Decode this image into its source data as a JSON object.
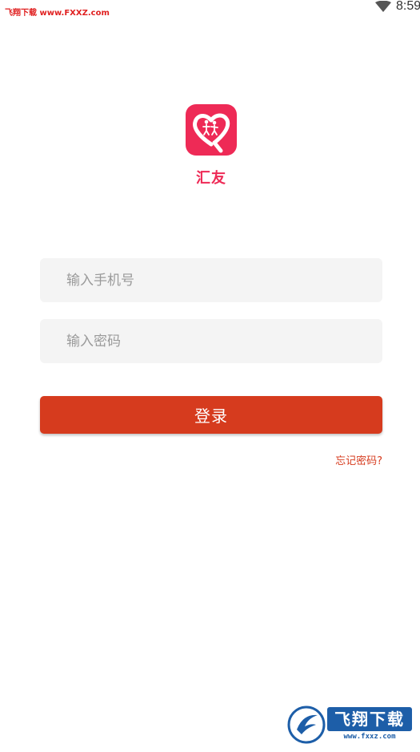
{
  "status_bar": {
    "watermark": "飞翔下载 www.FXXZ.com",
    "time": "8:59",
    "wifi_icon": "wifi-icon"
  },
  "app": {
    "name": "汇友",
    "logo_icon": "heart-couple-icon",
    "brand_color": "#ee2a56"
  },
  "login_form": {
    "phone_placeholder": "输入手机号",
    "password_placeholder": "输入密码",
    "login_label": "登录",
    "forgot_password_label": "忘记密码?",
    "accent_color": "#d63b1e"
  },
  "bottom_watermark": {
    "title": "飞翔下载",
    "url": "www.fxxz.com",
    "color": "#1d5ea8"
  }
}
